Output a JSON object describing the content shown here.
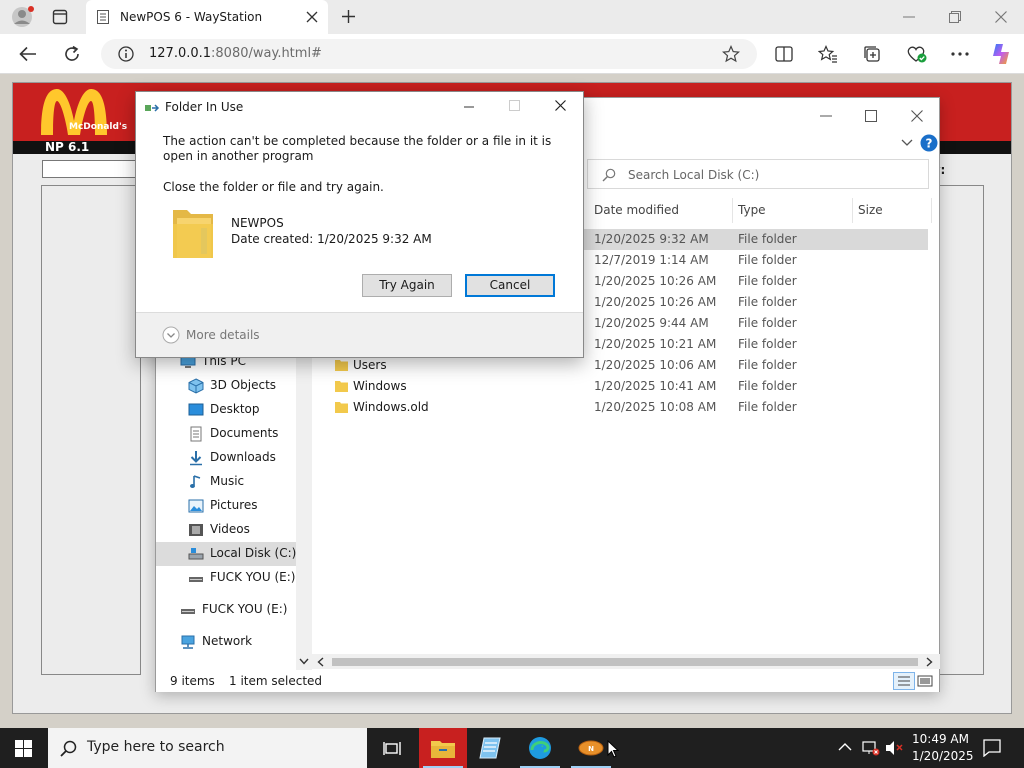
{
  "browser": {
    "tab_title": "NewPOS 6 - WayStation",
    "url_host": "127.0.0.1",
    "url_rest": ":8080/way.html#"
  },
  "pos": {
    "logo_text": "McDonald's",
    "version": "NP 6.1",
    "label": "ay:"
  },
  "explorer": {
    "search_placeholder": "Search Local Disk (C:)",
    "columns": {
      "date": "Date modified",
      "type": "Type",
      "size": "Size"
    },
    "rows": [
      {
        "name": "",
        "date": "1/20/2025 9:32 AM",
        "type": "File folder"
      },
      {
        "name": "",
        "date": "12/7/2019 1:14 AM",
        "type": "File folder"
      },
      {
        "name": "",
        "date": "1/20/2025 10:26 AM",
        "type": "File folder"
      },
      {
        "name": "",
        "date": "1/20/2025 10:26 AM",
        "type": "File folder"
      },
      {
        "name": "",
        "date": "1/20/2025 9:44 AM",
        "type": "File folder"
      },
      {
        "name": "",
        "date": "1/20/2025 10:21 AM",
        "type": "File folder"
      },
      {
        "name": "Users",
        "date": "1/20/2025 10:06 AM",
        "type": "File folder"
      },
      {
        "name": "Windows",
        "date": "1/20/2025 10:41 AM",
        "type": "File folder"
      },
      {
        "name": "Windows.old",
        "date": "1/20/2025 10:08 AM",
        "type": "File folder"
      }
    ],
    "nav": [
      {
        "label": "This PC",
        "icon": "pc-icon"
      },
      {
        "label": "3D Objects",
        "icon": "cube-icon"
      },
      {
        "label": "Desktop",
        "icon": "desktop-icon"
      },
      {
        "label": "Documents",
        "icon": "document-icon"
      },
      {
        "label": "Downloads",
        "icon": "download-icon"
      },
      {
        "label": "Music",
        "icon": "music-icon"
      },
      {
        "label": "Pictures",
        "icon": "pictures-icon"
      },
      {
        "label": "Videos",
        "icon": "videos-icon"
      },
      {
        "label": "Local Disk (C:)",
        "icon": "drive-icon"
      },
      {
        "label": "FUCK YOU (E:)",
        "icon": "usb-drive-icon"
      },
      {
        "label": "FUCK YOU (E:)",
        "icon": "usb-drive-icon"
      },
      {
        "label": "Network",
        "icon": "network-icon"
      }
    ],
    "status_count": "9 items",
    "status_selected": "1 item selected"
  },
  "dialog": {
    "title": "Folder In Use",
    "message": "The action can't be completed because the folder or a file in it is open in another program",
    "sub": "Close the folder or file and try again.",
    "item_name": "NEWPOS",
    "item_date": "Date created: 1/20/2025 9:32 AM",
    "try_again": "Try Again",
    "cancel": "Cancel",
    "more_details": "More details"
  },
  "taskbar": {
    "search_placeholder": "Type here to search",
    "time": "10:49 AM",
    "date": "1/20/2025"
  },
  "colors": {
    "brand_red": "#c8201f",
    "accent_blue": "#0078d7",
    "folder": "#f2c94c"
  }
}
